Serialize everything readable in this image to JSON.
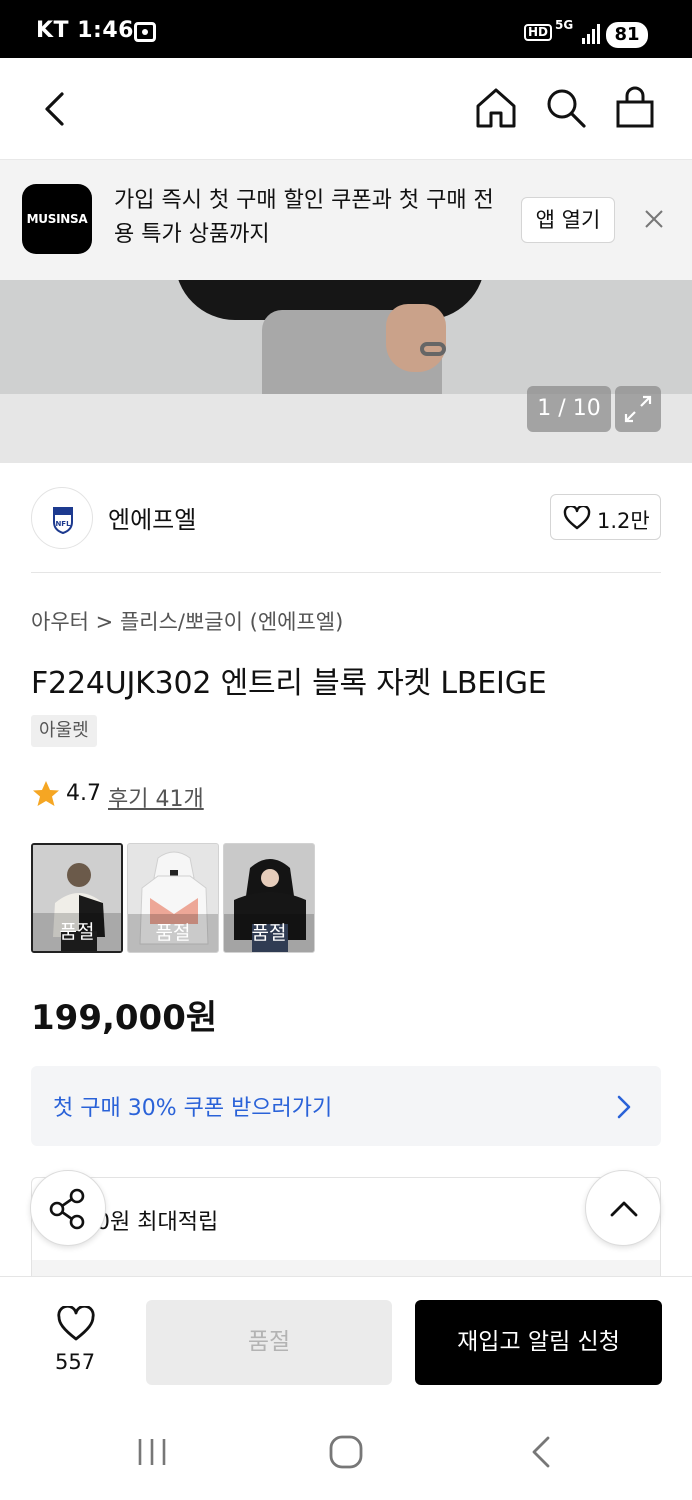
{
  "status_bar": {
    "carrier": "KT",
    "time": "1:46",
    "hd": "HD",
    "network": "5G",
    "battery": "81"
  },
  "banner": {
    "logo_text": "MUSINSA",
    "message": "가입 즉시 첫 구매 할인 쿠폰과 첫 구매 전용 특가 상품까지",
    "open_app": "앱 열기"
  },
  "gallery": {
    "counter": "1 / 10"
  },
  "brand": {
    "name": "엔에프엘",
    "likes": "1.2만"
  },
  "product": {
    "breadcrumb_1": "아우터",
    "breadcrumb_sep": ">",
    "breadcrumb_2": "플리스/뽀글이 (엔에프엘)",
    "title": "F224UJK302 엔트리 블록 자켓 LBEIGE",
    "tag": "아울렛",
    "rating": "4.7",
    "reviews": "후기 41개",
    "price": "199,000원"
  },
  "colors": {
    "soldout_label": "품절",
    "options": [
      {
        "name": "option-1",
        "soldout": "품절"
      },
      {
        "name": "option-2",
        "soldout": "품절"
      },
      {
        "name": "option-3",
        "soldout": "품절"
      }
    ]
  },
  "coupon": {
    "text": "첫 구매 30% 쿠폰 받으러가기"
  },
  "points": {
    "text": "0원 최대적립"
  },
  "bottom": {
    "wish_count": "557",
    "soldout_button": "품절",
    "restock_button": "재입고 알림 신청"
  },
  "accent_colors": {
    "coupon_text": "#2a62d8",
    "star": "#f5a623"
  }
}
